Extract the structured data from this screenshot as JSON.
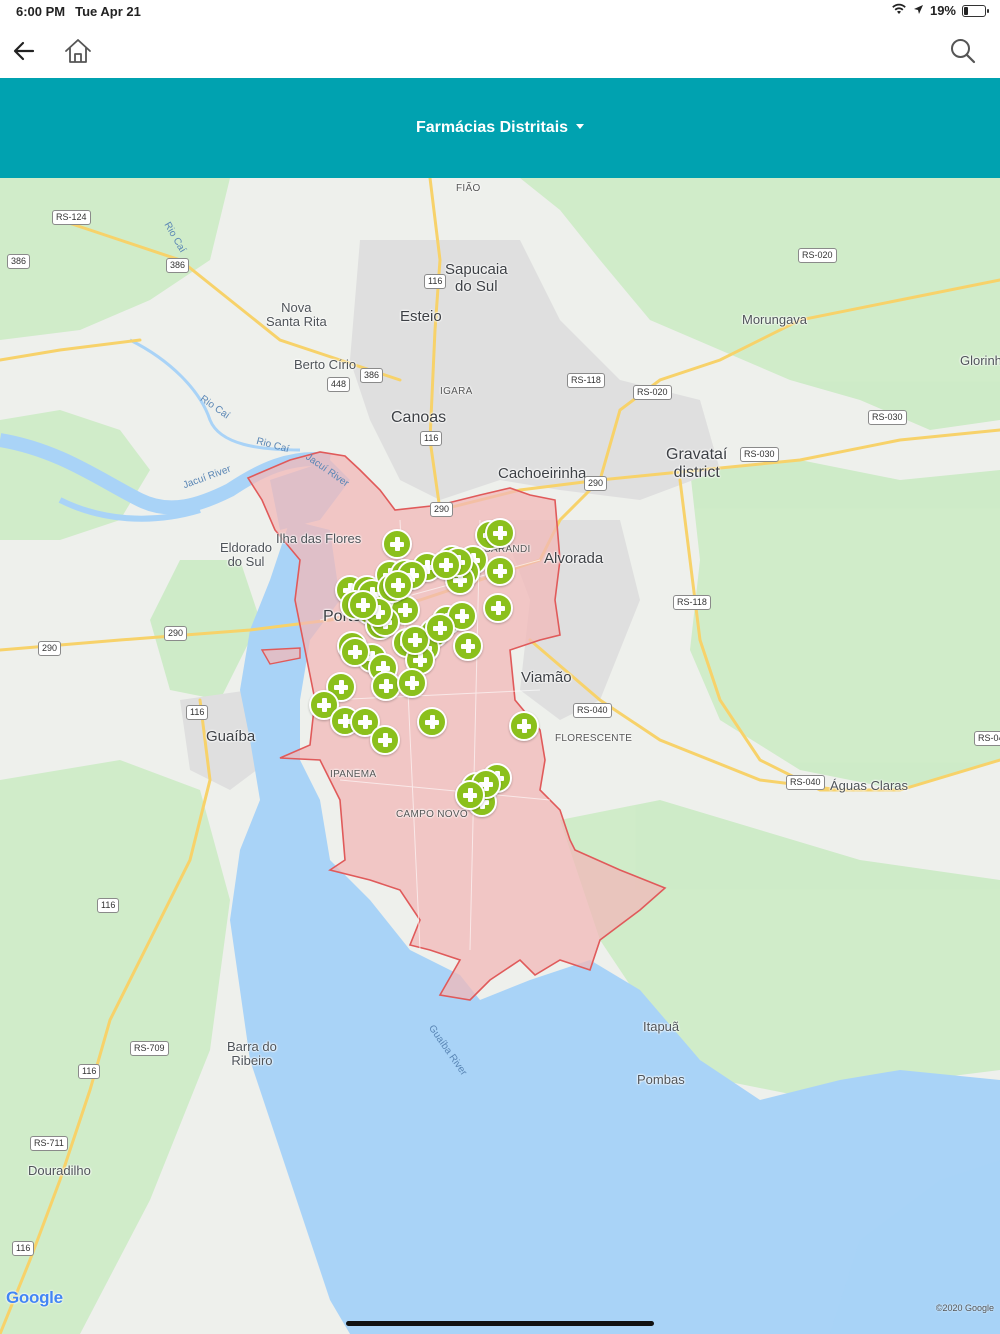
{
  "status_bar": {
    "time": "6:00 PM",
    "date": "Tue Apr 21",
    "battery": "19%",
    "battery_fraction": 0.19
  },
  "nav": {
    "back_icon": "arrow-left-icon",
    "home_icon": "home-icon",
    "search_icon": "search-icon"
  },
  "header": {
    "title": "Farmácias Distritais",
    "dropdown_icon": "caret-down-icon",
    "color": "#00a2b0"
  },
  "map": {
    "district_fill": "#f2b8b8",
    "marker_color": "#8bc01c",
    "marker_icon": "cross-icon",
    "marker_count": 56,
    "labels": {
      "fiao": "FIÃO",
      "sapucaia": "Sapucaia\ndo Sul",
      "esteio": "Esteio",
      "nova_santa_rita": "Nova\nSanta Rita",
      "berto_cirio": "Berto Círio",
      "igara": "IGARA",
      "canoas": "Canoas",
      "cachoeirinha": "Cachoeirinha",
      "gravatai": "Gravataí\ndistrict",
      "morungava": "Morungava",
      "glorinha": "Glorinha",
      "eldorado": "Eldorado\ndo Sul",
      "ilha_flores": "Ilha das Flores",
      "porto_alegre": "Porto Alegre",
      "sarandi": "SARANDI",
      "alvorada": "Alvorada",
      "viamao": "Viamão",
      "florescente": "FLORESCENTE",
      "aguas_claras": "Águas Claras",
      "guaiba": "Guaíba",
      "ipanema": "IPANEMA",
      "campo_novo": "CAMPO NOVO",
      "itapua": "Itapuã",
      "pombas": "Pombas",
      "barra_ribeiro": "Barra do\nRibeiro",
      "douradilho": "Douradilho",
      "rio_cai_1": "Rio Caí",
      "rio_cai_2": "Rio Caí",
      "rio_cai_3": "Rio Caí",
      "jacui_river_1": "Jacuí River",
      "jacui_river_2": "Jacuí River",
      "guaiba_river": "Guaíba River"
    },
    "roads": {
      "rs124": "RS-124",
      "r386a": "386",
      "r386b": "386",
      "r386c": "386",
      "r448": "448",
      "r116a": "116",
      "r116b": "116",
      "r116c": "116",
      "r116d": "116",
      "r116e": "116",
      "r116f": "116",
      "r290a": "290",
      "r290b": "290",
      "r290c": "290",
      "r290d": "290",
      "rs020a": "RS-020",
      "rs020b": "RS-020",
      "rs118a": "RS-118",
      "rs118b": "RS-118",
      "rs030a": "RS-030",
      "rs030b": "RS-030",
      "rs040a": "RS-040",
      "rs040b": "RS-040",
      "rs040c": "RS-04",
      "rs709": "RS-709",
      "rs711": "RS-711"
    },
    "attribution": {
      "logo": "Google",
      "copyright": "©2020 Google"
    }
  }
}
